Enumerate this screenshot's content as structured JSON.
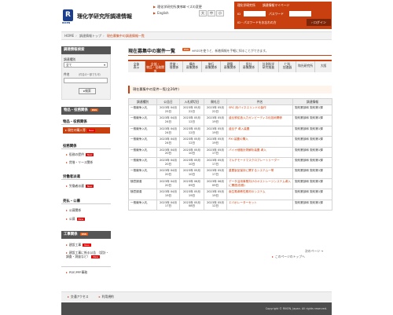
{
  "header": {
    "logo_text": "R",
    "logo_sub": "RIKEN",
    "site_title": "理化学研究所調達情報",
    "home_link": "理化学研究所ホーム",
    "english_link": "English",
    "font_size_label": "文字サイズの変更",
    "font_sizes": [
      "大",
      "中",
      "小"
    ]
  },
  "login": {
    "top_links": [
      "理化学研究所",
      "調達情報マイページ"
    ],
    "id_label": "ID",
    "password_label": "パスワード",
    "forgot_link": "ID・パスワードをお忘れの方",
    "login_button": "ログイン"
  },
  "breadcrumb": [
    "HOME",
    "調達情報トップ",
    "現在募集中の調達情報一覧"
  ],
  "sidebar": {
    "search_head": "調達情報検索",
    "category_label": "調達種別",
    "category_value": "全て",
    "keyword_label": "件名",
    "keyword_hint": "（件名の一部でも可）",
    "search_button": "検索",
    "procurement_head": "物品・役務関係",
    "procurement_section": "物品・役務関係",
    "procurement_items": [
      "現在の購入等",
      "お知らせ",
      "落札情報"
    ],
    "notice_section": "役務関係",
    "notice_items": [
      "役務の提供",
      "賃借・リース関係"
    ],
    "labor_section": "労働者派遣",
    "labor_items": [
      "労働者派遣"
    ],
    "auction_section": "売払・公募",
    "auction_items": [
      "公募関係",
      "公募"
    ],
    "construction_head": "工事関係",
    "construction_items": [
      "建設工事",
      "建設工事に係る公告 （設計・調査・測量など）"
    ],
    "rss_label": "RSS",
    "new_label": "New",
    "pdf_label": "PDF/PPP事務"
  },
  "main": {
    "title": "現在募集中の案件一覧",
    "rss_label": "RSS",
    "rss_text": "※RSSを使うと、新着情報を手軽に知ることができます。",
    "filters": [
      [
        "全体",
        "表示"
      ],
      [
        "全部・",
        "物品・役務関係"
      ],
      [
        "賃貸・",
        "借関係"
      ],
      [
        "構外",
        "募集関係"
      ],
      [
        "施行",
        "募集関係"
      ],
      [
        "建築",
        "募集関係"
      ],
      [
        "設計",
        "募集関係"
      ],
      [
        "計測科学",
        "研究推進"
      ],
      [
        "仁科",
        "加速器"
      ],
      [
        "和光研究所"
      ],
      [
        "大",
        "阪"
      ]
    ],
    "list_heading": "現在募集中の案件一覧(全26件)",
    "columns": [
      "調達種別",
      "公告日",
      "入札締切日",
      "開札日",
      "件名",
      "調達情報"
    ],
    "rows": [
      {
        "type": "一般競争入札",
        "notice": "2023年 04月25日",
        "deadline": "2023年 05月22日",
        "open": "2023年 05月22日",
        "subject": "SRC 用バイネスリンドの製作",
        "info": "契約業部和 契約第1課"
      },
      {
        "type": "一般競争入札",
        "notice": "2023年 04月24日",
        "deadline": "2023年 05月12日",
        "open": "2023年 05月19日",
        "subject": "遺伝鉄鉱造入力ガンビーディネ化技術関係",
        "info": "契約業部和 契約第1課"
      },
      {
        "type": "一般競争入札",
        "notice": "2023年 04月24日",
        "deadline": "2023年 05月12日",
        "open": "2023年 05月19日",
        "subject": "遺伝子 導入装置",
        "info": "契約業部和 契約第1課"
      },
      {
        "type": "一般競争入札",
        "notice": "2023年 04月24日",
        "deadline": "2023年 05月12日",
        "open": "2023年 05月19日",
        "subject": "PXI 装置の購入",
        "info": "契約業部和 契約第1課"
      },
      {
        "type": "一般競争入札",
        "notice": "2023年 04月20日",
        "deadline": "2023年 05月10日",
        "open": "2023年 05月17日",
        "subject": "バイオ細胞計測解析装置 導入",
        "info": "契約業部和 契約第1課"
      },
      {
        "type": "一般競争入札",
        "notice": "2023年 04月20日",
        "deadline": "2023年 05月10日",
        "open": "2023年 05月17日",
        "subject": "マルチモードマスクロプレートリーダー",
        "info": "契約業部和 契約第1課"
      },
      {
        "type": "一般競争入札",
        "notice": "2023年 04月20日",
        "deadline": "2023年 05月10日",
        "open": "2023年 05月17日",
        "subject": "重要製品保持に関するシステム一帯",
        "info": "契約業部和 契約第1課"
      },
      {
        "type": "随意調達",
        "notice": "2023年 04月20日",
        "deadline": "2023年 06月09日",
        "open": "2023年 06月09日",
        "subject": "データ活用事業向けのオストレージシステム導入に関連(役務)",
        "info": "契約業部和 契約第1課"
      },
      {
        "type": "随意調達",
        "notice": "2023年 04月19日",
        "deadline": "2023年 05月19日",
        "open": "2023年 05月19日",
        "subject": "南生電導教性素材のシステム",
        "info": "契約業部和 契約第1課"
      },
      {
        "type": "一般競争入札",
        "notice": "2023年 04月17日",
        "deadline": "2023年 05月08日",
        "open": "2023年 05月12日",
        "subject": "エバポレーターセット",
        "info": "契約業部和 契約第1課"
      }
    ],
    "next_link": "次のページ",
    "top_link": "このページのトップへ"
  },
  "footer": {
    "links": [
      "交通アクセス",
      "利用規約"
    ],
    "copyright": "Copyright © RIKEN, Japan. All rights reserved."
  },
  "colors": {
    "accent": "#c8400f",
    "brand": "#1a3e8c"
  }
}
